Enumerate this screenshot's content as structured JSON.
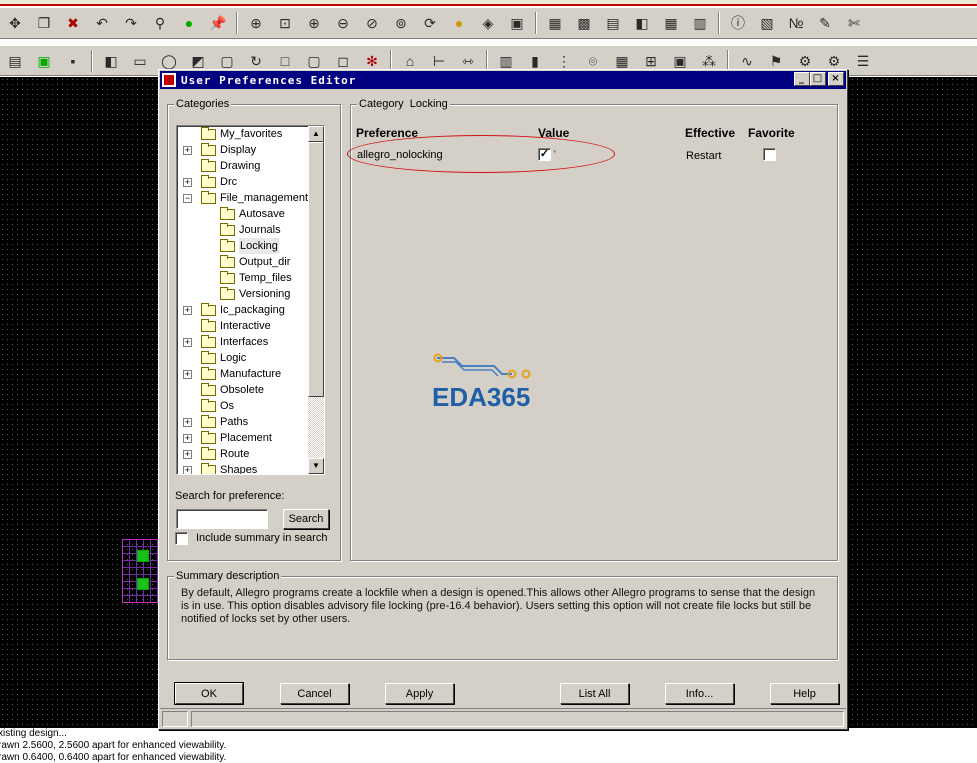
{
  "dialog": {
    "title": "User Preferences Editor",
    "buttons": {
      "ok": "OK",
      "cancel": "Cancel",
      "apply": "Apply",
      "list_all": "List All",
      "info": "Info...",
      "help": "Help"
    }
  },
  "categories": {
    "label": "Categories",
    "items": [
      {
        "label": "My_favorites",
        "level": 0,
        "expandable": false,
        "selected": false
      },
      {
        "label": "Display",
        "level": 0,
        "expandable": true,
        "selected": false
      },
      {
        "label": "Drawing",
        "level": 0,
        "expandable": false,
        "selected": false
      },
      {
        "label": "Drc",
        "level": 0,
        "expandable": true,
        "selected": false
      },
      {
        "label": "File_management",
        "level": 0,
        "expandable": true,
        "expanded": true,
        "selected": false
      },
      {
        "label": "Autosave",
        "level": 1,
        "expandable": false,
        "selected": false
      },
      {
        "label": "Journals",
        "level": 1,
        "expandable": false,
        "selected": false
      },
      {
        "label": "Locking",
        "level": 1,
        "expandable": false,
        "selected": true
      },
      {
        "label": "Output_dir",
        "level": 1,
        "expandable": false,
        "selected": false
      },
      {
        "label": "Temp_files",
        "level": 1,
        "expandable": false,
        "selected": false
      },
      {
        "label": "Versioning",
        "level": 1,
        "expandable": false,
        "selected": false
      },
      {
        "label": "Ic_packaging",
        "level": 0,
        "expandable": true,
        "selected": false
      },
      {
        "label": "Interactive",
        "level": 0,
        "expandable": false,
        "selected": false
      },
      {
        "label": "Interfaces",
        "level": 0,
        "expandable": true,
        "selected": false
      },
      {
        "label": "Logic",
        "level": 0,
        "expandable": false,
        "selected": false
      },
      {
        "label": "Manufacture",
        "level": 0,
        "expandable": true,
        "selected": false
      },
      {
        "label": "Obsolete",
        "level": 0,
        "expandable": false,
        "selected": false
      },
      {
        "label": "Os",
        "level": 0,
        "expandable": false,
        "selected": false
      },
      {
        "label": "Paths",
        "level": 0,
        "expandable": true,
        "selected": false
      },
      {
        "label": "Placement",
        "level": 0,
        "expandable": true,
        "selected": false
      },
      {
        "label": "Route",
        "level": 0,
        "expandable": true,
        "selected": false
      },
      {
        "label": "Shapes",
        "level": 0,
        "expandable": true,
        "selected": false
      }
    ]
  },
  "search": {
    "label": "Search for preference:",
    "value": "",
    "button": "Search",
    "include_summary_label": "Include summary in search",
    "include_summary_checked": false
  },
  "category_panel": {
    "category_label": "Category",
    "category_value": "Locking",
    "headers": {
      "preference": "Preference",
      "value": "Value",
      "effective": "Effective",
      "favorite": "Favorite"
    },
    "rows": [
      {
        "preference": "allegro_nolocking",
        "value_checked": true,
        "effective": "Restart",
        "favorite_checked": false
      }
    ]
  },
  "watermark": {
    "text": "EDA365",
    "color": "#1f5fa8",
    "accent": "#e8a020"
  },
  "summary": {
    "label": "Summary description",
    "text": "By default, Allegro programs create a lockfile when a design is opened.This allows other Allegro programs to sense that the design is in use. This option disables advisory file locking (pre-16.4 behavior). Users setting this option will not create file locks but still be notified of locks set by other users."
  },
  "console": {
    "lines": [
      "xisting design...",
      "rawn 2.5600, 2.5600 apart for enhanced viewability.",
      "rawn 0.6400, 0.6400 apart for enhanced viewability."
    ]
  },
  "colors": {
    "titlebar": "#000080",
    "dialog_bg": "#d4d0c8",
    "annotation": "#d01010",
    "canvas": "#000000"
  }
}
